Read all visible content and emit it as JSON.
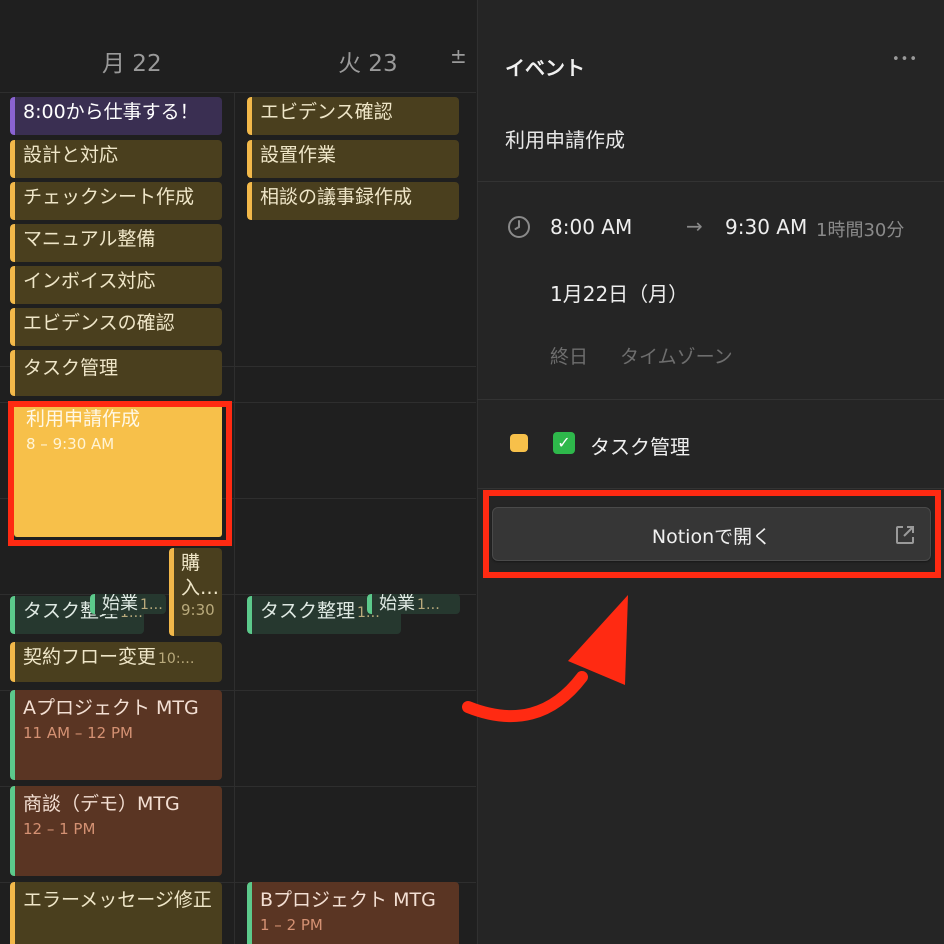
{
  "calendar": {
    "days": [
      {
        "label": "月 22"
      },
      {
        "label": "火 23"
      }
    ],
    "add_label": "±",
    "col1_events": [
      {
        "title": "8:00から仕事する！"
      },
      {
        "title": "設計と対応"
      },
      {
        "title": "チェックシート作成"
      },
      {
        "title": "マニュアル整備"
      },
      {
        "title": "インボイス対応"
      },
      {
        "title": "エビデンスの確認"
      },
      {
        "title": "タスク管理"
      },
      {
        "title": "利用申請作成",
        "time": "8 – 9:30 AM"
      },
      {
        "title": "購入…",
        "time": "9:30"
      },
      {
        "title": "タスク整理",
        "time": "1…"
      },
      {
        "title": "始業",
        "time": "1…"
      },
      {
        "title": "契約フロー変更",
        "time": "10:…"
      },
      {
        "title": "Aプロジェクト MTG",
        "time": "11 AM – 12 PM"
      },
      {
        "title": "商談（デモ）MTG",
        "time": "12 – 1 PM"
      },
      {
        "title": "エラーメッセージ修正"
      }
    ],
    "col2_events": [
      {
        "title": "エビデンス確認"
      },
      {
        "title": "設置作業"
      },
      {
        "title": "相談の議事録作成"
      },
      {
        "title": "タスク整理",
        "time": "1…"
      },
      {
        "title": "始業",
        "time": "1…"
      },
      {
        "title": "Bプロジェクト MTG",
        "time": "1 – 2 PM"
      }
    ]
  },
  "panel": {
    "header": "イベント",
    "more_icon": "•••",
    "event_title": "利用申請作成",
    "start_time": "8:00 AM",
    "arrow": "→",
    "end_time": "9:30 AM",
    "duration": "1時間30分",
    "date": "1月22日（月）",
    "all_day": "終日",
    "timezone": "タイムゾーン",
    "checkbox": "✓",
    "task_label": "タスク管理",
    "open_button": "Notionで開く",
    "colors": {
      "accent_yellow": "#f7c04a",
      "check_green": "#2eb84b",
      "highlight_red": "#ff2a12"
    }
  }
}
